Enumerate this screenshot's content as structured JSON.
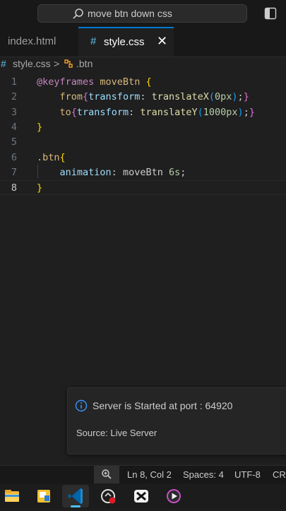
{
  "titlebar": {
    "search_text": "move btn down css"
  },
  "tabs": [
    {
      "label": "index.html",
      "active": false
    },
    {
      "label": "style.css",
      "active": true,
      "close": "✕"
    }
  ],
  "breadcrumb": {
    "hash": "#",
    "file": "style.css",
    "separator": ">",
    "symbol": ".btn"
  },
  "editor": {
    "line_numbers": [
      "1",
      "2",
      "3",
      "4",
      "5",
      "6",
      "7",
      "8"
    ],
    "active_line": 8,
    "lines": [
      [
        {
          "t": "@keyframes",
          "c": "kw"
        },
        {
          "t": " ",
          "c": "pl"
        },
        {
          "t": "moveBtn",
          "c": "nm"
        },
        {
          "t": " ",
          "c": "pl"
        },
        {
          "t": "{",
          "c": "br1"
        }
      ],
      [
        {
          "t": "    from",
          "c": "nm"
        },
        {
          "t": "{",
          "c": "br2"
        },
        {
          "t": "transform",
          "c": "prop"
        },
        {
          "t": ": ",
          "c": "pl"
        },
        {
          "t": "translateX",
          "c": "fn"
        },
        {
          "t": "(",
          "c": "br3"
        },
        {
          "t": "0px",
          "c": "num"
        },
        {
          "t": ")",
          "c": "br3"
        },
        {
          "t": ";",
          "c": "pl"
        },
        {
          "t": "}",
          "c": "br2"
        }
      ],
      [
        {
          "t": "    to",
          "c": "nm"
        },
        {
          "t": "{",
          "c": "br2"
        },
        {
          "t": "transform",
          "c": "prop"
        },
        {
          "t": ": ",
          "c": "pl"
        },
        {
          "t": "translateY",
          "c": "fn"
        },
        {
          "t": "(",
          "c": "br3"
        },
        {
          "t": "1000px",
          "c": "num"
        },
        {
          "t": ")",
          "c": "br3"
        },
        {
          "t": ";",
          "c": "pl"
        },
        {
          "t": "}",
          "c": "br2"
        }
      ],
      [
        {
          "t": "}",
          "c": "br1"
        }
      ],
      [],
      [
        {
          "t": ".btn",
          "c": "nm"
        },
        {
          "t": "{",
          "c": "br1"
        }
      ],
      [
        {
          "t": "    animation",
          "c": "prop"
        },
        {
          "t": ": ",
          "c": "pl"
        },
        {
          "t": "moveBtn",
          "c": "pl"
        },
        {
          "t": " ",
          "c": "pl"
        },
        {
          "t": "6s",
          "c": "num"
        },
        {
          "t": ";",
          "c": "pl"
        }
      ],
      [
        {
          "t": "}",
          "c": "br1"
        }
      ]
    ]
  },
  "notification": {
    "message": "Server is Started at port : 64920",
    "source": "Source: Live Server",
    "icon": "info-icon"
  },
  "statusbar": {
    "position": "Ln 8, Col 2",
    "spaces": "Spaces: 4",
    "encoding": "UTF-8",
    "eol": "CRL"
  },
  "taskbar": {
    "apps": [
      "file-explorer-icon",
      "folder-app-icon",
      "vscode-icon",
      "screen-recorder-icon",
      "capcut-icon",
      "media-player-icon"
    ],
    "active_app": "vscode-icon"
  },
  "colors": {
    "accent": "#0078d4",
    "css_icon": "#519aba",
    "background": "#1f1f1f"
  }
}
